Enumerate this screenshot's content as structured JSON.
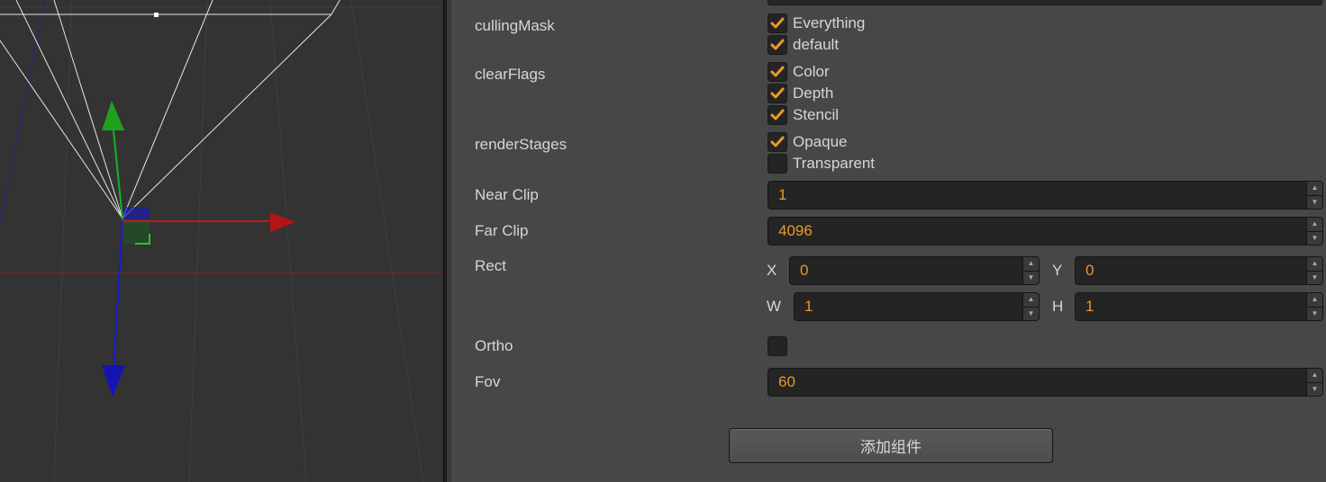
{
  "colors": {
    "accent_orange": "#e99a28",
    "label_text": "#d6d6d6",
    "panel_bg": "#474747",
    "viewport_bg": "#333333",
    "gizmo_x": "#c01717",
    "gizmo_y": "#19b319",
    "gizmo_z": "#1a1ad0"
  },
  "viewport": {
    "gizmo": [
      "move-gizmo-x-arrow",
      "move-gizmo-y-arrow",
      "move-gizmo-z-arrow"
    ],
    "frustum": "camera-frustum-wireframe"
  },
  "inspector": {
    "cullingMask": {
      "label": "cullingMask",
      "options": [
        {
          "label": "Everything",
          "checked": true
        },
        {
          "label": "default",
          "checked": true
        }
      ]
    },
    "clearFlags": {
      "label": "clearFlags",
      "options": [
        {
          "label": "Color",
          "checked": true
        },
        {
          "label": "Depth",
          "checked": true
        },
        {
          "label": "Stencil",
          "checked": true
        }
      ]
    },
    "renderStages": {
      "label": "renderStages",
      "options": [
        {
          "label": "Opaque",
          "checked": true
        },
        {
          "label": "Transparent",
          "checked": false
        }
      ]
    },
    "nearClip": {
      "label": "Near Clip",
      "value": "1"
    },
    "farClip": {
      "label": "Far Clip",
      "value": "4096"
    },
    "rect": {
      "label": "Rect",
      "x": {
        "label": "X",
        "value": "0"
      },
      "y": {
        "label": "Y",
        "value": "0"
      },
      "w": {
        "label": "W",
        "value": "1"
      },
      "h": {
        "label": "H",
        "value": "1"
      }
    },
    "ortho": {
      "label": "Ortho",
      "checked": false
    },
    "fov": {
      "label": "Fov",
      "value": "60"
    },
    "add_component_label": "添加组件",
    "spinner_up": "▲",
    "spinner_down": "▼",
    "check_glyph": "✔"
  }
}
